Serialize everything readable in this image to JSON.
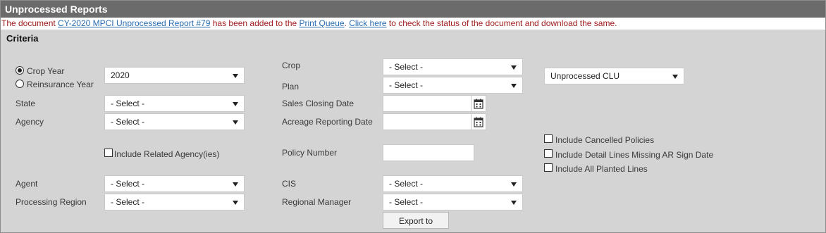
{
  "window": {
    "title": "Unprocessed Reports"
  },
  "notice": {
    "prefix": "The document ",
    "document_link": "CY-2020 MPCI Unprocessed Report #79",
    "middle": " has been added to the ",
    "queue_link": "Print Queue",
    "after_queue": ". ",
    "click_link": "Click here",
    "suffix": " to check the status of the document and download the same."
  },
  "criteria": {
    "title": "Criteria",
    "year_type": {
      "crop_year_label": "Crop Year",
      "reinsurance_year_label": "Reinsurance Year",
      "selected": "crop_year"
    },
    "year_select": {
      "value": "2020"
    },
    "state": {
      "label": "State",
      "value": "- Select -"
    },
    "agency": {
      "label": "Agency",
      "value": "- Select -"
    },
    "include_related_agency": {
      "label": "Include Related Agency(ies)",
      "checked": false
    },
    "agent": {
      "label": "Agent",
      "value": "- Select -"
    },
    "processing_region": {
      "label": "Processing Region",
      "value": "- Select -"
    },
    "crop": {
      "label": "Crop",
      "value": "- Select -"
    },
    "plan": {
      "label": "Plan",
      "value": "- Select -"
    },
    "sales_closing_date": {
      "label": "Sales Closing Date",
      "value": ""
    },
    "acreage_reporting_date": {
      "label": "Acreage Reporting Date",
      "value": ""
    },
    "policy_number": {
      "label": "Policy Number",
      "value": ""
    },
    "cis": {
      "label": "CIS",
      "value": "- Select -"
    },
    "regional_manager": {
      "label": "Regional Manager",
      "value": "- Select -"
    },
    "report_type": {
      "value": "Unprocessed CLU"
    },
    "include_cancelled_policies": {
      "label": "Include Cancelled Policies",
      "checked": false
    },
    "include_detail_lines_missing": {
      "label": "Include Detail Lines Missing AR Sign Date",
      "checked": false
    },
    "include_all_planted_lines": {
      "label": "Include All Planted Lines",
      "checked": false
    }
  },
  "actions": {
    "export_label": "Export to Excel"
  },
  "icons": {
    "calendar": "calendar-icon",
    "dropdown": "chevron-down-icon"
  },
  "colors": {
    "titlebar": "#6b6b6b",
    "panel": "#d4d4d4",
    "notice_text": "#a11d1d",
    "link": "#2a6db0"
  }
}
